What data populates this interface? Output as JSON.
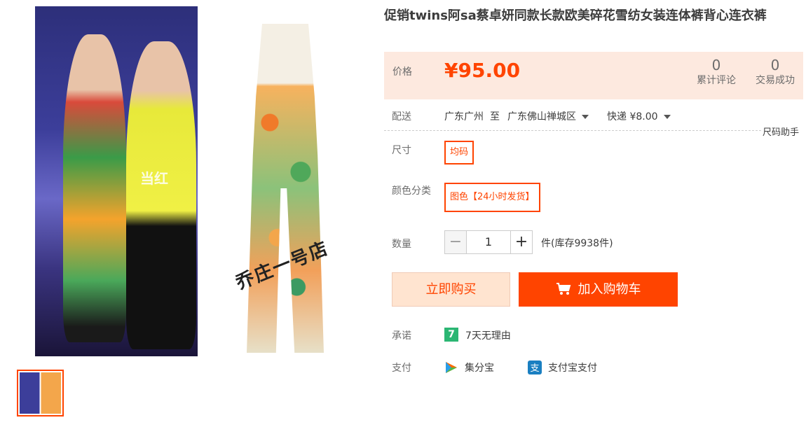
{
  "gallery": {
    "main_image_logo": "当红",
    "watermark": "乔庄一号店"
  },
  "product": {
    "title": "促销twins阿sa蔡卓妍同款长款欧美碎花雪纺女装连体裤背心连衣裤",
    "price_label": "价格",
    "price": "¥95.00",
    "reviews_count": "0",
    "reviews_label": "累计评论",
    "deals_count": "0",
    "deals_label": "交易成功"
  },
  "shipping": {
    "label": "配送",
    "from": "广东广州",
    "to_word": "至",
    "to": "广东佛山禅城区",
    "method": "快递 ¥8.00"
  },
  "size_helper": "尺码助手",
  "size": {
    "label": "尺寸",
    "options": [
      "均码"
    ]
  },
  "color": {
    "label": "颜色分类",
    "options": [
      "图色【24小时发货】"
    ]
  },
  "quantity": {
    "label": "数量",
    "value": "1",
    "minus": "−",
    "plus": "+",
    "stock": "件(库存9938件)"
  },
  "actions": {
    "buy_now": "立即购买",
    "add_to_cart": "加入购物车"
  },
  "promise": {
    "label": "承诺",
    "icon_text": "7",
    "text": "7天无理由"
  },
  "payment": {
    "label": "支付",
    "methods": [
      "集分宝",
      "支付宝支付"
    ]
  },
  "colors": {
    "accent": "#ff4400",
    "price_bg": "#fde9df",
    "buy_now_bg": "#ffe4d0"
  }
}
